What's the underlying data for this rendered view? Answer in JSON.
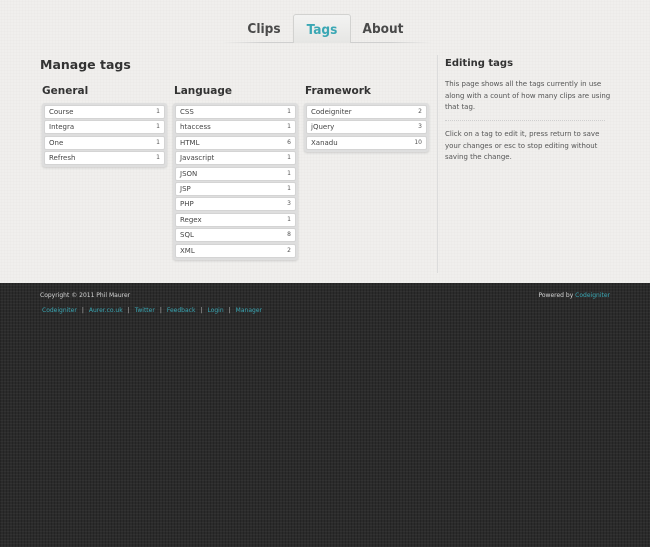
{
  "nav": {
    "tabs": [
      {
        "label": "Clips"
      },
      {
        "label": "Tags"
      },
      {
        "label": "About"
      }
    ]
  },
  "main": {
    "title": "Manage tags",
    "columns": [
      {
        "heading": "General",
        "tags": [
          {
            "name": "Course",
            "count": "1"
          },
          {
            "name": "Integra",
            "count": "1"
          },
          {
            "name": "One",
            "count": "1"
          },
          {
            "name": "Refresh",
            "count": "1"
          }
        ]
      },
      {
        "heading": "Language",
        "tags": [
          {
            "name": "CSS",
            "count": "1"
          },
          {
            "name": "htaccess",
            "count": "1"
          },
          {
            "name": "HTML",
            "count": "6"
          },
          {
            "name": "Javascript",
            "count": "1"
          },
          {
            "name": "JSON",
            "count": "1"
          },
          {
            "name": "JSP",
            "count": "1"
          },
          {
            "name": "PHP",
            "count": "3"
          },
          {
            "name": "Regex",
            "count": "1"
          },
          {
            "name": "SQL",
            "count": "8"
          },
          {
            "name": "XML",
            "count": "2"
          }
        ]
      },
      {
        "heading": "Framework",
        "tags": [
          {
            "name": "Codeigniter",
            "count": "2"
          },
          {
            "name": "jQuery",
            "count": "3"
          },
          {
            "name": "Xanadu",
            "count": "10"
          }
        ]
      }
    ]
  },
  "sidebar": {
    "title": "Editing tags",
    "p1": "This page shows all the tags currently in use along with a count of how many clips are using that tag.",
    "p2": "Click on a tag to edit it, press return to save your changes or esc to stop editing without saving the change."
  },
  "footer": {
    "copyright": "Copyright © 2011 Phil Maurer",
    "powered_prefix": "Powered by",
    "powered_link": "Codeigniter",
    "links": [
      {
        "label": "Codeigniter"
      },
      {
        "label": "Aurer.co.uk"
      },
      {
        "label": "Twitter"
      },
      {
        "label": "Feedback"
      },
      {
        "label": "Login"
      },
      {
        "label": "Manager"
      }
    ],
    "separator": "|"
  },
  "colors": {
    "accent": "#3aa7b4",
    "footer_bg": "#2b2b2b",
    "page_bg": "#f0efed"
  }
}
